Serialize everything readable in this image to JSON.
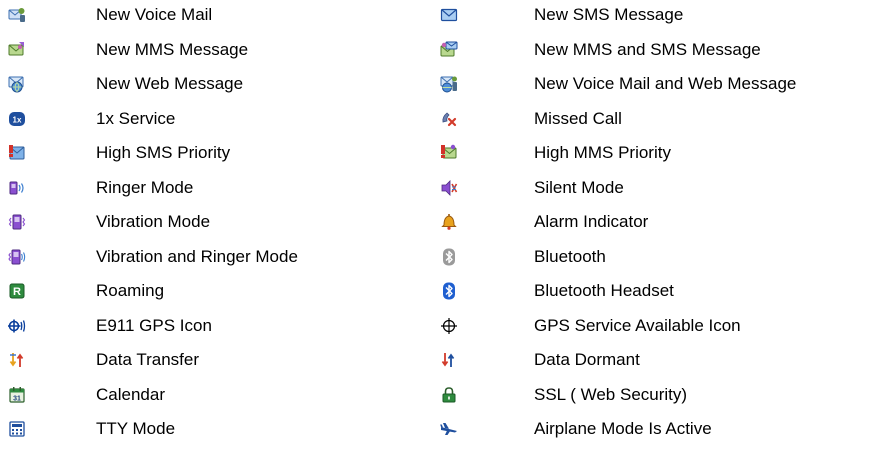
{
  "colors": {
    "blue": "#1f6fd6",
    "dark_blue": "#0a3f9c",
    "purple": "#8a4fd0",
    "green": "#2e8b3e",
    "red": "#d23b2b",
    "orange": "#e8a21e",
    "gray": "#8a8a8a"
  },
  "left_column": [
    {
      "icon": "new-voice-mail-icon",
      "label": "New Voice Mail"
    },
    {
      "icon": "new-mms-message-icon",
      "label": "New MMS Message"
    },
    {
      "icon": "new-web-message-icon",
      "label": "New Web Message"
    },
    {
      "icon": "1x-service-icon",
      "label": "1x Service"
    },
    {
      "icon": "high-sms-priority-icon",
      "label": "High SMS Priority"
    },
    {
      "icon": "ringer-mode-icon",
      "label": "Ringer Mode"
    },
    {
      "icon": "vibration-mode-icon",
      "label": "Vibration Mode"
    },
    {
      "icon": "vibration-and-ringer-mode-icon",
      "label": "Vibration and Ringer Mode"
    },
    {
      "icon": "roaming-icon",
      "label": "Roaming"
    },
    {
      "icon": "e911-gps-icon",
      "label": "E911 GPS Icon"
    },
    {
      "icon": "data-transfer-icon",
      "label": "Data Transfer"
    },
    {
      "icon": "calendar-icon",
      "label": "Calendar"
    },
    {
      "icon": "tty-mode-icon",
      "label": "TTY Mode"
    }
  ],
  "right_column": [
    {
      "icon": "new-sms-message-icon",
      "label": "New SMS Message"
    },
    {
      "icon": "new-mms-and-sms-message-icon",
      "label": "New MMS and SMS Message"
    },
    {
      "icon": "new-voice-mail-and-web-message-icon",
      "label": "New Voice Mail and Web Message"
    },
    {
      "icon": "missed-call-icon",
      "label": "Missed Call"
    },
    {
      "icon": "high-mms-priority-icon",
      "label": "High MMS Priority"
    },
    {
      "icon": "silent-mode-icon",
      "label": "Silent Mode"
    },
    {
      "icon": "alarm-indicator-icon",
      "label": "Alarm Indicator"
    },
    {
      "icon": "bluetooth-icon",
      "label": "Bluetooth"
    },
    {
      "icon": "bluetooth-headset-icon",
      "label": "Bluetooth Headset"
    },
    {
      "icon": "gps-service-available-icon",
      "label": "GPS Service Available Icon"
    },
    {
      "icon": "data-dormant-icon",
      "label": "Data Dormant"
    },
    {
      "icon": "ssl-web-security-icon",
      "label": "SSL ( Web Security)"
    },
    {
      "icon": "airplane-mode-icon",
      "label": "Airplane Mode Is Active"
    }
  ]
}
